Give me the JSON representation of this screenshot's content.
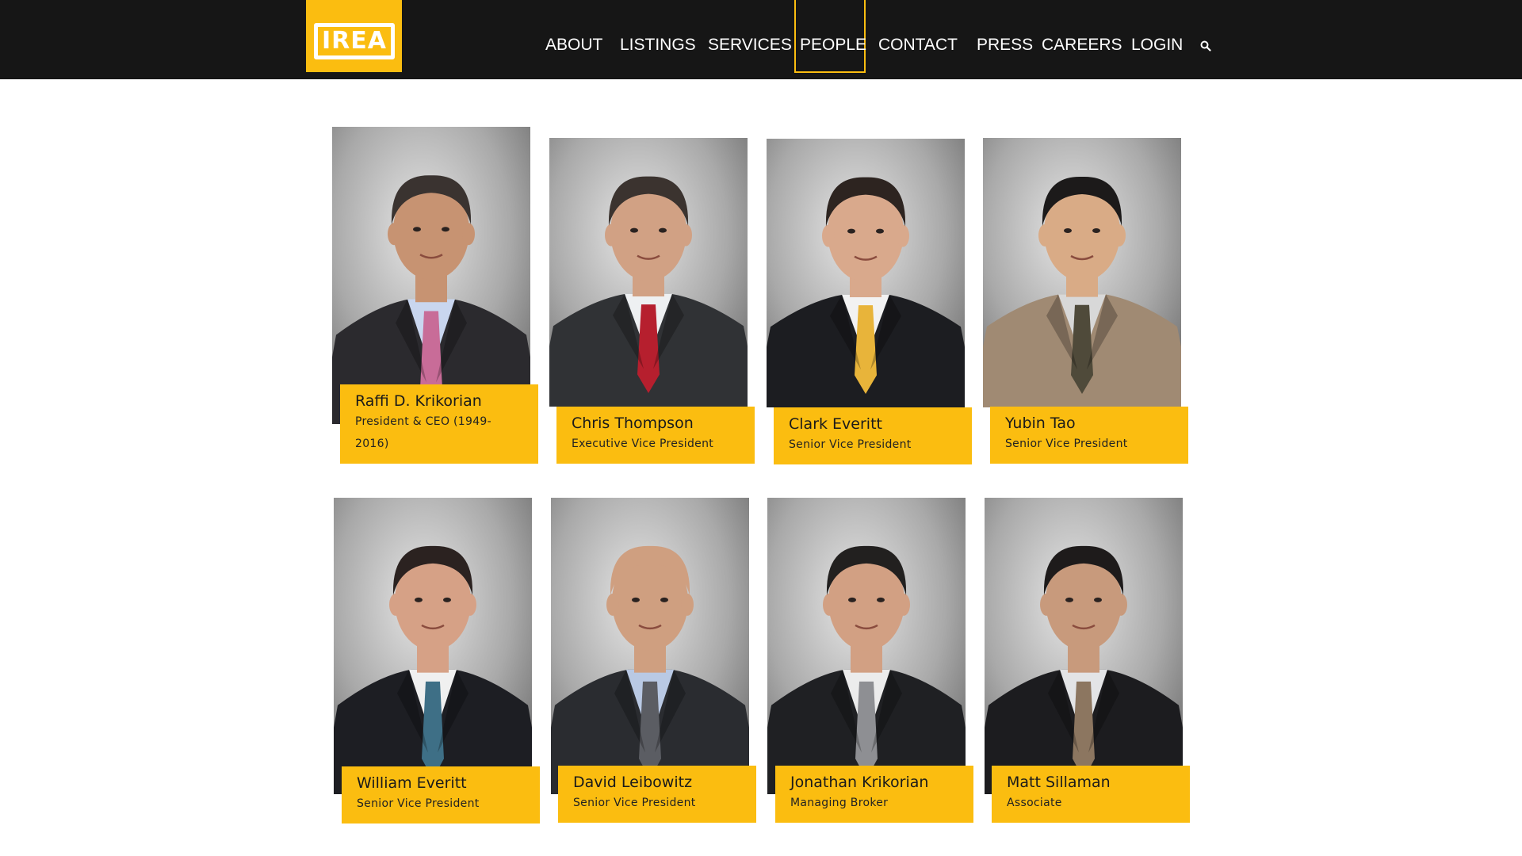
{
  "brand": {
    "logo_text": "IREA",
    "accent_color": "#fbbd10",
    "header_bg": "#161616"
  },
  "nav": {
    "items": [
      {
        "label": "ABOUT"
      },
      {
        "label": "LISTINGS"
      },
      {
        "label": "SERVICES"
      },
      {
        "label": "PEOPLE",
        "active": true
      },
      {
        "label": "CONTACT"
      },
      {
        "label": "PRESS"
      },
      {
        "label": "CAREERS"
      },
      {
        "label": "LOGIN"
      }
    ],
    "search_icon": "search-icon"
  },
  "people": [
    {
      "name": "Raffi D. Krikorian",
      "title": "President & CEO (1949-2016)",
      "suit": "#2b2a2e",
      "shirt": "#c9d6ef",
      "tie": "#c86c98",
      "skin": "#c79372",
      "hair": "#3a3330"
    },
    {
      "name": "Chris Thompson",
      "title": "Executive Vice President",
      "suit": "#303235",
      "shirt": "#eef0f2",
      "tie": "#b61f2e",
      "skin": "#d1a184",
      "hair": "#3b332f"
    },
    {
      "name": "Clark Everitt",
      "title": "Senior Vice President",
      "suit": "#1c1d21",
      "shirt": "#f2f2f2",
      "tie": "#e8b43a",
      "skin": "#d9a98c",
      "hair": "#2d2420"
    },
    {
      "name": "Yubin Tao",
      "title": "Senior Vice President",
      "suit": "#a08a73",
      "shirt": "#d8d8d8",
      "tie": "#4f4a3a",
      "skin": "#d9ab86",
      "hair": "#1c1a1a"
    },
    {
      "name": "William Everitt",
      "title": "Senior Vice President",
      "suit": "#1d1e23",
      "shirt": "#f0f0f0",
      "tie": "#3e6f86",
      "skin": "#d6a186",
      "hair": "#2b2220"
    },
    {
      "name": "David Leibowitz",
      "title": "Senior Vice President",
      "suit": "#2a2c30",
      "shirt": "#b9c9e4",
      "tie": "#5b5d63",
      "skin": "#cf9f80",
      "hair": "#cf9f80"
    },
    {
      "name": "Jonathan Krikorian",
      "title": "Managing Broker",
      "suit": "#1f2023",
      "shirt": "#ececec",
      "tie": "#8e8f93",
      "skin": "#d2a083",
      "hair": "#22201f"
    },
    {
      "name": "Matt Sillaman",
      "title": "Associate",
      "suit": "#1c1c1f",
      "shirt": "#e3e4e6",
      "tie": "#8c7660",
      "skin": "#c89a7c",
      "hair": "#1e1b1b"
    }
  ]
}
